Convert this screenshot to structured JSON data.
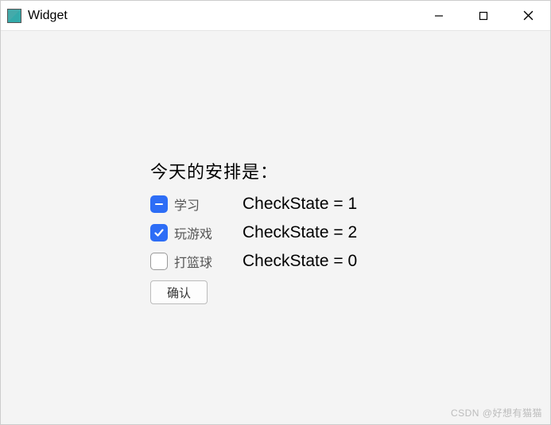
{
  "window": {
    "title": "Widget"
  },
  "heading": "今天的安排是：",
  "options": [
    {
      "label": "学习",
      "state_text": "CheckState = 1",
      "state": "partial"
    },
    {
      "label": "玩游戏",
      "state_text": "CheckState = 2",
      "state": "checked"
    },
    {
      "label": "打篮球",
      "state_text": "CheckState = 0",
      "state": "unchecked"
    }
  ],
  "confirm_label": "确认",
  "watermark": "CSDN @好想有猫猫"
}
